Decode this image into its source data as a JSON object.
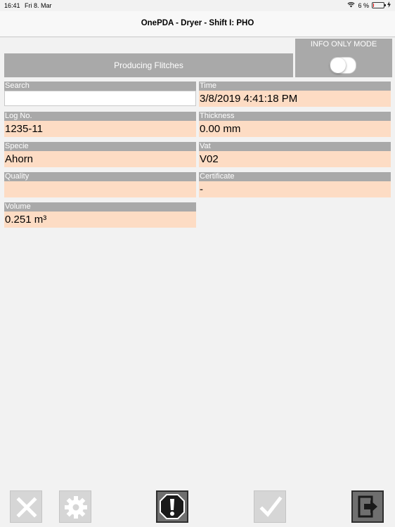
{
  "status_bar": {
    "time": "16:41",
    "date": "Fri 8. Mar",
    "battery_text": "6 %",
    "battery_level": 0.06,
    "battery_color": "#e00000"
  },
  "nav": {
    "title": "OnePDA - Dryer - Shift I: PHO"
  },
  "state": {
    "label": "Producing Flitches"
  },
  "info_mode": {
    "label": "INFO ONLY MODE",
    "enabled": false
  },
  "fields": {
    "search": {
      "label": "Search",
      "value": "",
      "placeholder": ""
    },
    "time": {
      "label": "Time",
      "value": "3/8/2019 4:41:18 PM"
    },
    "log_no": {
      "label": "Log No.",
      "value": "1235-11"
    },
    "thickness": {
      "label": "Thickness",
      "value": "0.00 mm"
    },
    "specie": {
      "label": "Specie",
      "value": "Ahorn"
    },
    "vat": {
      "label": "Vat",
      "value": "V02"
    },
    "quality": {
      "label": "Quality",
      "value": ""
    },
    "certificate": {
      "label": "Certificate",
      "value": "-"
    },
    "volume": {
      "label": "Volume",
      "value": "0.251 m³"
    }
  },
  "toolbar": [
    {
      "icon": "close-icon",
      "enabled": false
    },
    {
      "icon": "gear-icon",
      "enabled": false
    },
    {
      "icon": "alert-icon",
      "enabled": true
    },
    {
      "icon": "checkmark-icon",
      "enabled": false
    },
    {
      "icon": "exit-icon",
      "enabled": true
    }
  ],
  "colors": {
    "header_gray": "#a9a9a9",
    "value_peach": "#fddcc4",
    "background": "#f2f2f2"
  }
}
